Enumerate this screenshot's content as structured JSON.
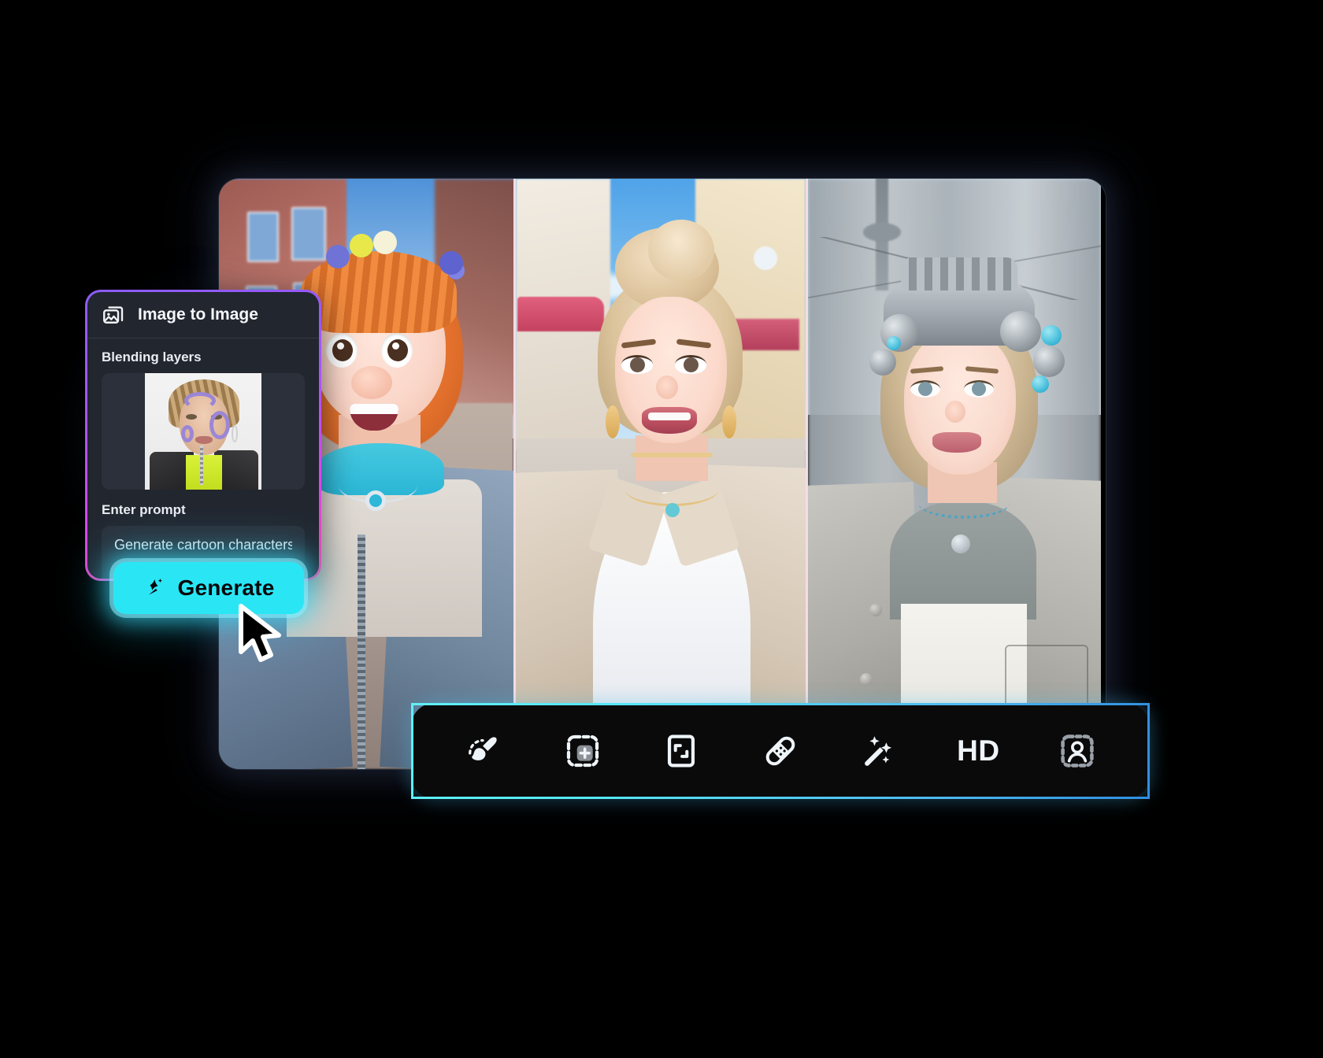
{
  "app": {
    "background_color": "#000000",
    "accent_cyan": "#2ae6f5",
    "panel_border_gradient": [
      "#8b5cf6",
      "#a855f7",
      "#d946ef",
      "#ec4899"
    ],
    "toolbar_border_gradient": [
      "#5ff0f7",
      "#4fb9ee",
      "#2f8fe0"
    ],
    "panel_background": "#22262f",
    "field_background": "#2b303a",
    "toolbar_background": "#0a0a0b"
  },
  "panel": {
    "icon_name": "image-to-image-icon",
    "title": "Image to Image",
    "blending": {
      "label": "Blending layers",
      "thumbnail_name": "blending-layer-thumbnail",
      "thumbnail_alt": "Portrait of woman with braided hair and purple face paint"
    },
    "prompt": {
      "label": "Enter prompt",
      "value": "Generate cartoon characters",
      "placeholder": "Enter prompt"
    }
  },
  "generate_button": {
    "label": "Generate",
    "icon_name": "sparkle-star-icon",
    "state": "hovered"
  },
  "cursor": {
    "icon_name": "mouse-pointer-arrow",
    "fill": "#000000",
    "stroke": "#ffffff"
  },
  "canvas": {
    "panes": [
      {
        "name": "result-image-1",
        "alt": "Cartoon girl with orange hair and flowers on a brick street"
      },
      {
        "name": "result-image-2",
        "alt": "Stylized blonde woman with a bun on a sunny street"
      },
      {
        "name": "result-image-3",
        "alt": "Woman wearing a mechanical cyber headset in a city"
      }
    ],
    "divider_color": "#f3dde6"
  },
  "toolbar": {
    "items": [
      {
        "icon_name": "brush-icon",
        "label": ""
      },
      {
        "icon_name": "add-selection-icon",
        "label": ""
      },
      {
        "icon_name": "expand-frame-icon",
        "label": ""
      },
      {
        "icon_name": "bandage-heal-icon",
        "label": ""
      },
      {
        "icon_name": "magic-wand-icon",
        "label": ""
      },
      {
        "icon_name": "hd-quality-label",
        "label": "HD"
      },
      {
        "icon_name": "person-cutout-icon",
        "label": ""
      }
    ]
  }
}
